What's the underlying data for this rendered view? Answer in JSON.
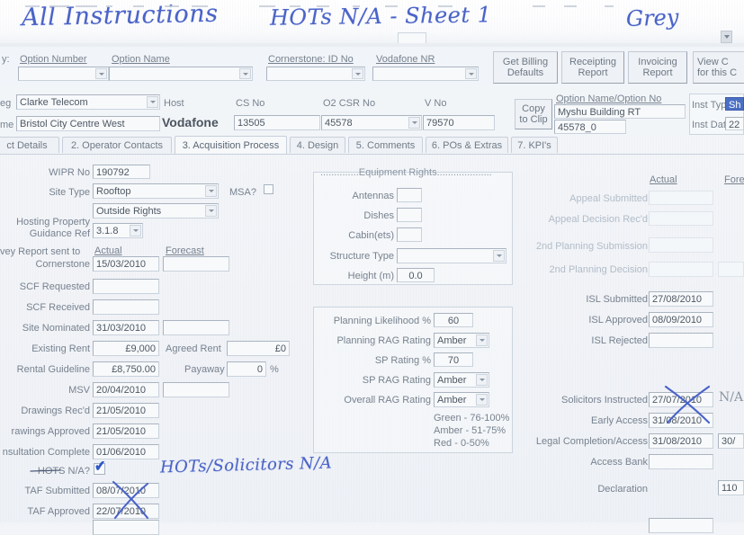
{
  "annotations": {
    "title_left": "All Instructions",
    "title_center": "HOTs N/A  - Sheet 1",
    "title_right": "Grey",
    "hots_note": "HOTs/Solicitors N/A",
    "na_right": "N/A",
    "ink_color": "#4a63c8"
  },
  "searchbar": {
    "prefix_label": "y:",
    "option_number_label": "Option Number",
    "option_number_value": "",
    "option_name_label": "Option Name",
    "option_name_value": "",
    "cornerstone_id_label": "Cornerstone: ID No",
    "cornerstone_id_value": "",
    "vodafone_nr_label": "Vodafone NR",
    "vodafone_nr_value": ""
  },
  "toolbar_buttons": [
    {
      "line1": "Get Billing",
      "line2": "Defaults"
    },
    {
      "line1": "Receipting",
      "line2": "Report"
    },
    {
      "line1": "Invoicing",
      "line2": "Report"
    },
    {
      "line1": "View C",
      "line2": "for this C"
    }
  ],
  "header": {
    "reg_label": "eg",
    "reg_value": "Clarke Telecom",
    "name_label": "me",
    "name_value": "Bristol City Centre West",
    "host_label": "Host",
    "host_value": "Vodafone",
    "cs_no_label": "CS No",
    "cs_no_value": "13505",
    "o2_csr_no_label": "O2 CSR No",
    "o2_csr_no_value": "45578",
    "v_no_label": "V No",
    "v_no_value": "79570",
    "copy_to_clip_line1": "Copy",
    "copy_to_clip_line2": "to Clip",
    "option_name_no_label": "Option Name/Option No",
    "option_name_value": "Myshu Building RT",
    "option_no_value": "45578_0",
    "inst_type_label": "Inst Type",
    "inst_type_value": "Sh",
    "inst_date_label": "Inst Date",
    "inst_date_value": "22"
  },
  "tabs": [
    {
      "label": "ct Details",
      "active": false
    },
    {
      "label": "2. Operator Contacts",
      "active": false
    },
    {
      "label": "3. Acquisition Process",
      "active": true
    },
    {
      "label": "4. Design",
      "active": false
    },
    {
      "label": "5. Comments",
      "active": false
    },
    {
      "label": "6. POs & Extras",
      "active": false
    },
    {
      "label": "7. KPI's",
      "active": false
    }
  ],
  "left_panel": {
    "wipr_no_label": "WIPR No",
    "wipr_no_value": "190792",
    "site_type_label": "Site Type",
    "site_type_value": "Rooftop",
    "msa_label": "MSA?",
    "msa_checked": false,
    "rights_value": "Outside Rights",
    "hosting_label_line1": "Hosting Property",
    "hosting_label_line2": "Guidance Ref",
    "hosting_value": "3.1.8",
    "col_actual": "Actual",
    "col_forecast": "Forecast",
    "survey_label_line1": "vey Report sent to",
    "survey_label_line2": "Cornerstone",
    "rows": [
      {
        "label": "Cornerstone",
        "actual": "15/03/2010",
        "forecast": "",
        "has_forecast": true
      },
      {
        "label": "SCF Requested",
        "actual": "",
        "forecast": "",
        "has_forecast": false
      },
      {
        "label": "SCF Received",
        "actual": "",
        "forecast": "",
        "has_forecast": false
      },
      {
        "label": "Site Nominated",
        "actual": "31/03/2010",
        "forecast": "",
        "has_forecast": true
      }
    ],
    "existing_rent_label": "Existing Rent",
    "existing_rent_value": "£9,000",
    "agreed_rent_label": "Agreed Rent",
    "agreed_rent_value": "£0",
    "rental_guideline_label": "Rental Guideline",
    "rental_guideline_value": "£8,750.00",
    "payaway_label": "Payaway",
    "payaway_value": "0",
    "payaway_unit": "%",
    "msv_label": "MSV",
    "msv_value": "20/04/2010",
    "msv_forecast": "",
    "drawings_recd_label": "Drawings Rec'd",
    "drawings_recd_value": "21/05/2010",
    "drawings_approved_label": "rawings Approved",
    "drawings_approved_value": "21/05/2010",
    "consultation_label": "nsultation Complete",
    "consultation_value": "01/06/2010",
    "hots_na_label": "HOTS N/A?",
    "hots_na_checked": true,
    "taf_submitted_label": "TAF Submitted",
    "taf_submitted_value": "08/07/2010",
    "taf_approved_label": "TAF Approved",
    "taf_approved_value": "22/07/2010"
  },
  "equipment_rights": {
    "group_title": "..............Equipment Rights....................",
    "antennas_label": "Antennas",
    "antennas_value": "",
    "dishes_label": "Dishes",
    "dishes_value": "",
    "cabinets_label": "Cabin(ets)",
    "cabinets_value": "",
    "structure_type_label": "Structure Type",
    "structure_type_value": "",
    "height_label": "Height (m)",
    "height_value": "0.0"
  },
  "rag_panel": {
    "planning_likelihood_label": "Planning Likelihood %",
    "planning_likelihood_value": "60",
    "planning_rag_label": "Planning RAG Rating",
    "planning_rag_value": "Amber",
    "sp_rating_label": "SP Rating %",
    "sp_rating_value": "70",
    "sp_rag_label": "SP RAG Rating",
    "sp_rag_value": "Amber",
    "overall_rag_label": "Overall RAG Rating",
    "overall_rag_value": "Amber",
    "legend": [
      "Green - 76-100%",
      "Amber - 51-75%",
      "Red - 0-50%"
    ]
  },
  "right_panel": {
    "col_actual": "Actual",
    "col_forecast": "Fore",
    "rows": [
      {
        "label": "Appeal Submitted",
        "actual": "",
        "forecast": "",
        "dim": true,
        "has_forecast": false
      },
      {
        "label": "Appeal Decision Rec'd",
        "actual": "",
        "forecast": "",
        "dim": true,
        "has_forecast": false
      },
      {
        "label": "2nd Planning Submission",
        "actual": "",
        "forecast": "",
        "dim": true,
        "has_forecast": false
      },
      {
        "label": "2nd Planning Decision",
        "actual": "",
        "forecast": "",
        "dim": true,
        "has_forecast": true
      },
      {
        "label": "ISL Submitted",
        "actual": "27/08/2010",
        "forecast": "",
        "dim": false,
        "has_forecast": false
      },
      {
        "label": "ISL Approved",
        "actual": "08/09/2010",
        "forecast": "",
        "dim": false,
        "has_forecast": false
      },
      {
        "label": "ISL Rejected",
        "actual": "",
        "forecast": "",
        "dim": false,
        "has_forecast": false
      }
    ],
    "solicitors_label": "Solicitors Instructed",
    "solicitors_value": "27/07/2010",
    "solicitors_na": "N/A",
    "early_access_label": "Early Access",
    "early_access_value": "31/08/2010",
    "legal_completion_label": "Legal Completion/Access",
    "legal_completion_value": "31/08/2010",
    "legal_completion_forecast": "30/",
    "access_bank_label": "Access Bank",
    "access_bank_value": "",
    "declaration_label": "Declaration",
    "declaration_value": "110"
  }
}
